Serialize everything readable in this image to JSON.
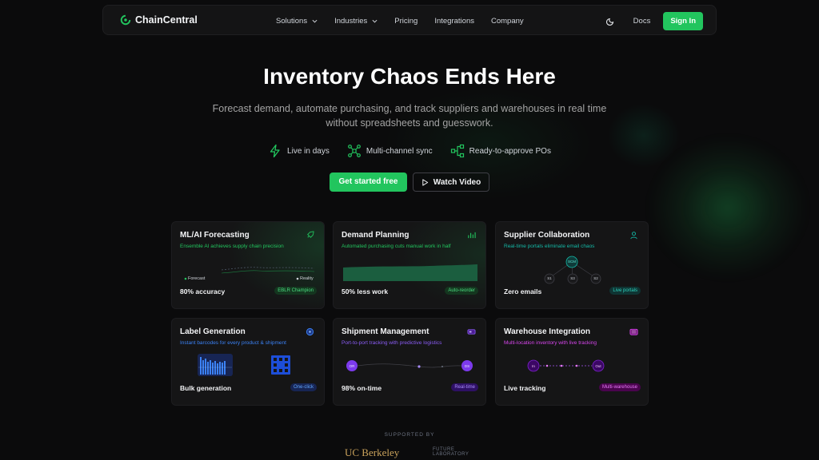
{
  "nav": {
    "brand": "ChainCentral",
    "links": [
      "Solutions",
      "Industries",
      "Pricing",
      "Integrations",
      "Company"
    ],
    "docs": "Docs",
    "signin": "Sign In"
  },
  "hero": {
    "title": "Inventory Chaos Ends Here",
    "subtitle_line1": "Forecast demand, automate purchasing, and track suppliers and warehouses in real time",
    "subtitle_line2": "without spreadsheets and guesswork.",
    "features": [
      "Live in days",
      "Multi-channel sync",
      "Ready-to-approve POs"
    ],
    "cta_primary": "Get started free",
    "cta_secondary": "Watch Video"
  },
  "cards": [
    {
      "title": "ML/AI Forecasting",
      "subtitle": "Ensemble AI achieves supply chain precision",
      "stat": "80% accuracy",
      "badge": "EBLR Champion",
      "legend_a": "Forecast",
      "legend_b": "Reality",
      "accent": "#22c55e"
    },
    {
      "title": "Demand Planning",
      "subtitle": "Automated purchasing cuts manual work in half",
      "stat": "50% less work",
      "badge": "Auto-reorder",
      "accent": "#22c55e"
    },
    {
      "title": "Supplier Collaboration",
      "subtitle": "Real-time portals eliminate email chaos",
      "stat": "Zero emails",
      "badge": "Live portals",
      "node_center": "SCM",
      "nodes": [
        "S1",
        "S3",
        "S2"
      ],
      "accent": "#14b8a6"
    },
    {
      "title": "Label Generation",
      "subtitle": "Instant barcodes for every product & shipment",
      "stat": "Bulk generation",
      "badge": "One-click",
      "accent": "#3b82f6"
    },
    {
      "title": "Shipment Management",
      "subtitle": "Port-to-port tracking with predictive logistics",
      "stat": "98% on-time",
      "badge": "Real-time",
      "node_from": "OR",
      "node_to": "DS",
      "accent": "#8b5cf6"
    },
    {
      "title": "Warehouse Integration",
      "subtitle": "Multi-location inventory with live tracking",
      "stat": "Live tracking",
      "badge": "Multi-warehouse",
      "node_in": "In",
      "node_out": "Out",
      "accent": "#c026d3"
    }
  ],
  "supported": {
    "label": "SUPPORTED BY",
    "logo1": "UC Berkeley",
    "logo2_line1": "FUTURE",
    "logo2_line2": "LABORATORY"
  }
}
